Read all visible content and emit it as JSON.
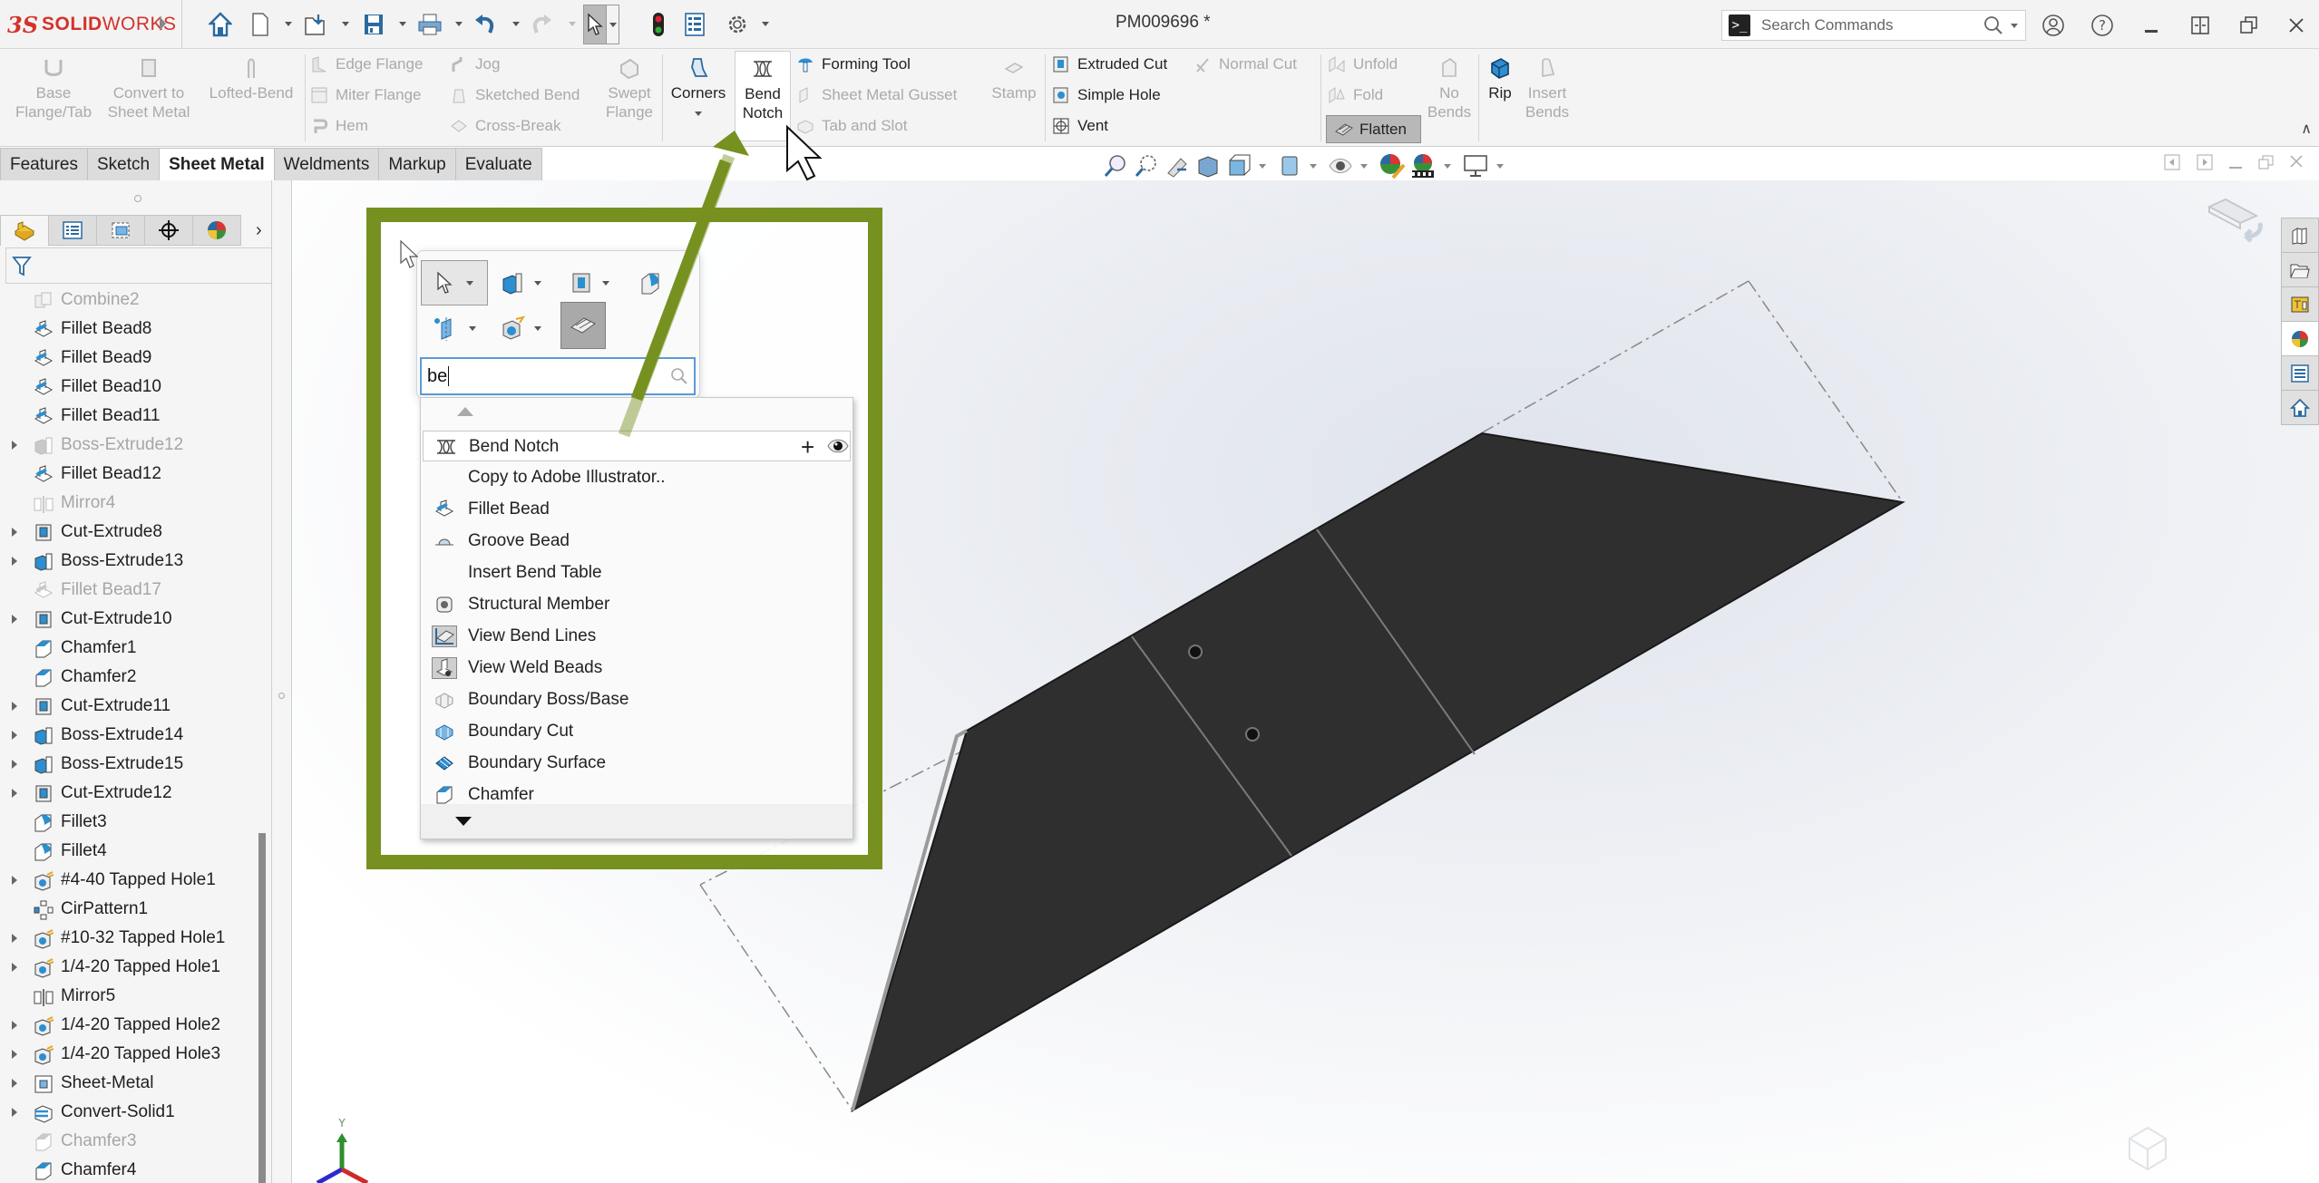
{
  "app": {
    "brand_prefix": "3S",
    "brand_bold": "SOLID",
    "brand_light": "WORKS",
    "document_title": "PM009696 *"
  },
  "quick_access": {
    "items": [
      {
        "name": "home",
        "icon": "home-icon"
      },
      {
        "name": "new",
        "icon": "new-document-icon",
        "has_dropdown": true
      },
      {
        "name": "open",
        "icon": "open-folder-icon",
        "has_dropdown": true
      },
      {
        "name": "save",
        "icon": "save-icon",
        "has_dropdown": true
      },
      {
        "name": "print",
        "icon": "print-icon",
        "has_dropdown": true
      },
      {
        "name": "undo",
        "icon": "undo-icon",
        "has_dropdown": true
      },
      {
        "name": "redo",
        "icon": "redo-icon",
        "has_dropdown": true,
        "disabled": true
      },
      {
        "name": "select",
        "icon": "select-cursor-icon",
        "has_dropdown": true,
        "active": true
      },
      {
        "name": "rebuild",
        "icon": "rebuild-traffic-light-icon"
      },
      {
        "name": "file-properties",
        "icon": "file-properties-icon"
      },
      {
        "name": "options",
        "icon": "gear-icon",
        "has_dropdown": true
      }
    ]
  },
  "search_commands": {
    "placeholder": "Search Commands"
  },
  "window_controls": [
    "user-icon",
    "help-icon",
    "minimize-icon",
    "tile-icon",
    "restore-icon",
    "close-icon"
  ],
  "ribbon": {
    "base_flange": "Base\nFlange/Tab",
    "base_flange_l1": "Base",
    "base_flange_l2": "Flange/Tab",
    "convert_l1": "Convert to",
    "convert_l2": "Sheet Metal",
    "lofted_bend": "Lofted-Bend",
    "edge_flange": "Edge Flange",
    "miter_flange": "Miter Flange",
    "hem": "Hem",
    "jog": "Jog",
    "sketched_bend": "Sketched Bend",
    "cross_break": "Cross-Break",
    "swept_l1": "Swept",
    "swept_l2": "Flange",
    "corners": "Corners",
    "bend_notch_l1": "Bend",
    "bend_notch_l2": "Notch",
    "forming_tool": "Forming Tool",
    "sheet_metal_gusset": "Sheet Metal Gusset",
    "tab_and_slot": "Tab and Slot",
    "stamp": "Stamp",
    "extruded_cut": "Extruded Cut",
    "simple_hole": "Simple Hole",
    "vent": "Vent",
    "normal_cut": "Normal Cut",
    "unfold": "Unfold",
    "fold": "Fold",
    "flatten": "Flatten",
    "no_bends_l1": "No",
    "no_bends_l2": "Bends",
    "rip": "Rip",
    "insert_bends_l1": "Insert",
    "insert_bends_l2": "Bends"
  },
  "tabs": [
    {
      "label": "Features",
      "active": false
    },
    {
      "label": "Sketch",
      "active": false
    },
    {
      "label": "Sheet Metal",
      "active": true
    },
    {
      "label": "Weldments",
      "active": false
    },
    {
      "label": "Markup",
      "active": false
    },
    {
      "label": "Evaluate",
      "active": false
    }
  ],
  "feature_manager": {
    "tabs": [
      "feature-tree-icon",
      "property-manager-icon",
      "configuration-manager-icon",
      "dimxpert-icon",
      "display-manager-icon"
    ],
    "filter_icon": "filter-icon",
    "items": [
      {
        "label": "Combine2",
        "icon": "combine",
        "suppressed": true,
        "expandable": false
      },
      {
        "label": "Fillet Bead8",
        "icon": "fillet-bead",
        "suppressed": false,
        "expandable": false
      },
      {
        "label": "Fillet Bead9",
        "icon": "fillet-bead",
        "suppressed": false,
        "expandable": false
      },
      {
        "label": "Fillet Bead10",
        "icon": "fillet-bead",
        "suppressed": false,
        "expandable": false
      },
      {
        "label": "Fillet Bead11",
        "icon": "fillet-bead",
        "suppressed": false,
        "expandable": false
      },
      {
        "label": "Boss-Extrude12",
        "icon": "boss-extrude",
        "suppressed": true,
        "expandable": true
      },
      {
        "label": "Fillet Bead12",
        "icon": "fillet-bead",
        "suppressed": false,
        "expandable": false
      },
      {
        "label": "Mirror4",
        "icon": "mirror",
        "suppressed": true,
        "expandable": false
      },
      {
        "label": "Cut-Extrude8",
        "icon": "cut-extrude",
        "suppressed": false,
        "expandable": true
      },
      {
        "label": "Boss-Extrude13",
        "icon": "boss-extrude",
        "suppressed": false,
        "expandable": true
      },
      {
        "label": "Fillet Bead17",
        "icon": "fillet-bead",
        "suppressed": true,
        "expandable": false
      },
      {
        "label": "Cut-Extrude10",
        "icon": "cut-extrude",
        "suppressed": false,
        "expandable": true
      },
      {
        "label": "Chamfer1",
        "icon": "chamfer",
        "suppressed": false,
        "expandable": false
      },
      {
        "label": "Chamfer2",
        "icon": "chamfer",
        "suppressed": false,
        "expandable": false
      },
      {
        "label": "Cut-Extrude11",
        "icon": "cut-extrude",
        "suppressed": false,
        "expandable": true
      },
      {
        "label": "Boss-Extrude14",
        "icon": "boss-extrude",
        "suppressed": false,
        "expandable": true
      },
      {
        "label": "Boss-Extrude15",
        "icon": "boss-extrude",
        "suppressed": false,
        "expandable": true
      },
      {
        "label": "Cut-Extrude12",
        "icon": "cut-extrude",
        "suppressed": false,
        "expandable": true
      },
      {
        "label": "Fillet3",
        "icon": "fillet",
        "suppressed": false,
        "expandable": false
      },
      {
        "label": "Fillet4",
        "icon": "fillet",
        "suppressed": false,
        "expandable": false
      },
      {
        "label": "#4-40 Tapped Hole1",
        "icon": "hole-wizard",
        "suppressed": false,
        "expandable": true
      },
      {
        "label": "CirPattern1",
        "icon": "circular-pattern",
        "suppressed": false,
        "expandable": false
      },
      {
        "label": "#10-32 Tapped Hole1",
        "icon": "hole-wizard",
        "suppressed": false,
        "expandable": true
      },
      {
        "label": "1/4-20 Tapped Hole1",
        "icon": "hole-wizard",
        "suppressed": false,
        "expandable": true
      },
      {
        "label": "Mirror5",
        "icon": "mirror",
        "suppressed": false,
        "expandable": false
      },
      {
        "label": "1/4-20 Tapped Hole2",
        "icon": "hole-wizard",
        "suppressed": false,
        "expandable": true
      },
      {
        "label": "1/4-20 Tapped Hole3",
        "icon": "hole-wizard",
        "suppressed": false,
        "expandable": true
      },
      {
        "label": "Sheet-Metal",
        "icon": "sheet-metal",
        "suppressed": false,
        "expandable": true
      },
      {
        "label": "Convert-Solid1",
        "icon": "convert-solid",
        "suppressed": false,
        "expandable": true
      },
      {
        "label": "Chamfer3",
        "icon": "chamfer",
        "suppressed": true,
        "expandable": false
      },
      {
        "label": "Chamfer4",
        "icon": "chamfer",
        "suppressed": false,
        "expandable": false
      }
    ]
  },
  "shortcut_bar": {
    "search_value": "be",
    "results": [
      {
        "label": "Bend Notch",
        "icon": "bend-notch",
        "highlighted": true
      },
      {
        "label": "Copy to Adobe Illustrator..",
        "icon": ""
      },
      {
        "label": "Fillet Bead",
        "icon": "fillet-bead"
      },
      {
        "label": "Groove Bead",
        "icon": "groove-bead"
      },
      {
        "label": "Insert Bend Table",
        "icon": ""
      },
      {
        "label": "Structural Member",
        "icon": "structural-member"
      },
      {
        "label": "View Bend Lines",
        "icon": "view-bend-lines",
        "toggled": true
      },
      {
        "label": "View Weld Beads",
        "icon": "view-weld-beads",
        "toggled": true
      },
      {
        "label": "Boundary Boss/Base",
        "icon": "boundary-boss"
      },
      {
        "label": "Boundary Cut",
        "icon": "boundary-cut"
      },
      {
        "label": "Boundary Surface",
        "icon": "boundary-surface"
      },
      {
        "label": "Chamfer",
        "icon": "chamfer"
      }
    ]
  },
  "triad": {
    "y_label": "Y"
  },
  "colors": {
    "brand_red": "#d4322b",
    "highlight_green": "#76911f",
    "part_dark": "#2e2e2e",
    "search_focus_blue": "#5a9bd8"
  }
}
